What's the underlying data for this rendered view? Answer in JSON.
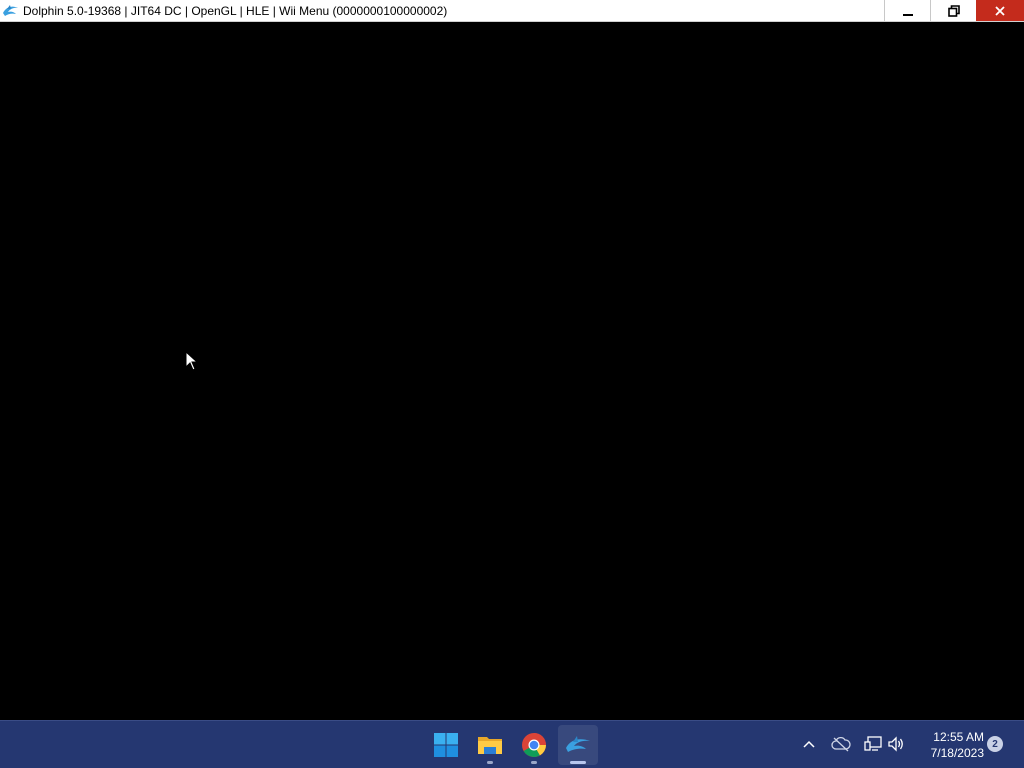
{
  "window": {
    "title": "Dolphin 5.0-19368 | JIT64 DC | OpenGL | HLE | Wii Menu (0000000100000002)",
    "app_icon": "dolphin-icon",
    "controls": {
      "minimize_icon": "minimize-icon",
      "restore_icon": "restore-icon",
      "close_icon": "close-icon"
    },
    "content": "render area (black)"
  },
  "taskbar": {
    "apps": [
      {
        "name": "Start",
        "icon": "windows-start-icon",
        "running": false,
        "active": false
      },
      {
        "name": "File Explorer",
        "icon": "folder-icon",
        "running": true,
        "active": false
      },
      {
        "name": "Google Chrome",
        "icon": "chrome-icon",
        "running": true,
        "active": false
      },
      {
        "name": "Dolphin",
        "icon": "dolphin-icon",
        "running": true,
        "active": true
      }
    ],
    "tray": {
      "icons": [
        "chevron-up-icon",
        "cloud-offline-icon",
        "network-icon",
        "volume-icon"
      ]
    },
    "clock": {
      "time": "12:55 AM",
      "date": "7/18/2023"
    },
    "notification_count": "2"
  },
  "colors": {
    "taskbar_bg": "#253771",
    "close_button": "#c42b1c",
    "window_bg": "#000000"
  }
}
